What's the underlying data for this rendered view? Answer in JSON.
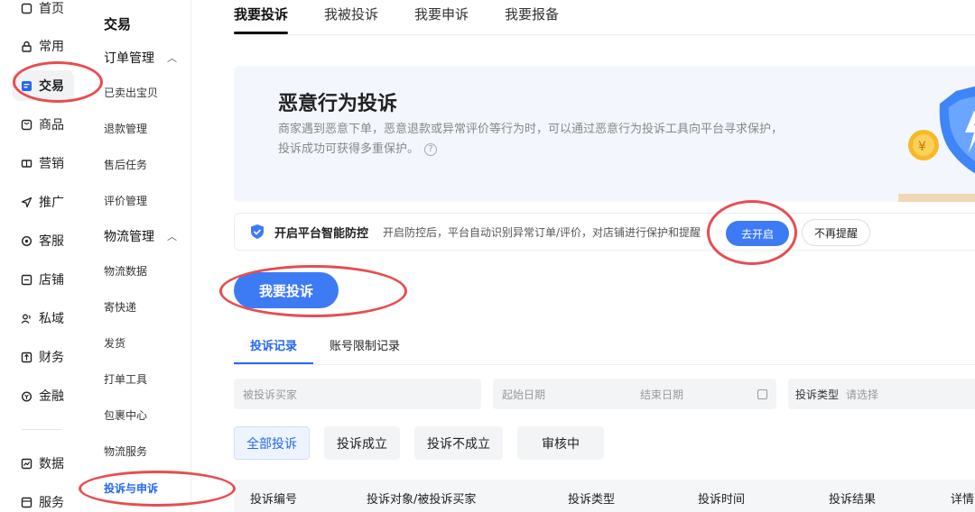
{
  "nav_primary": [
    {
      "label": "首页",
      "icon": "home-icon"
    },
    {
      "label": "常用",
      "icon": "lock-icon"
    },
    {
      "label": "交易",
      "icon": "document-icon",
      "active": true
    },
    {
      "label": "商品",
      "icon": "box-icon"
    },
    {
      "label": "营销",
      "icon": "ticket-icon"
    },
    {
      "label": "推广",
      "icon": "send-icon"
    },
    {
      "label": "客服",
      "icon": "headset-icon"
    },
    {
      "label": "店铺",
      "icon": "store-icon"
    },
    {
      "label": "私域",
      "icon": "users-icon"
    },
    {
      "label": "财务",
      "icon": "finance-icon"
    },
    {
      "label": "金融",
      "icon": "coin-icon"
    },
    {
      "label": "数据",
      "icon": "chart-icon"
    },
    {
      "label": "服务",
      "icon": "service-icon"
    }
  ],
  "nav_secondary": {
    "title": "交易",
    "order_group": "订单管理",
    "order_items": [
      "已卖出宝贝",
      "退款管理",
      "售后任务",
      "评价管理"
    ],
    "logistics_group": "物流管理",
    "logistics_items": [
      "物流数据",
      "寄快递",
      "发货",
      "打单工具",
      "包裹中心",
      "物流服务"
    ],
    "active_item": "投诉与申诉"
  },
  "tabs": [
    "我要投诉",
    "我被投诉",
    "我要申诉",
    "我要报备"
  ],
  "banner": {
    "title": "恶意行为投诉",
    "desc": "商家遇到恶意下单，恶意退款或异常评价等行为时，可以通过恶意行为投诉工具向平台寻求保护，投诉成功可获得多重保护。"
  },
  "notice": {
    "title": "开启平台智能防控",
    "desc": "开启防控后，平台自动识别异常订单/评价，对店铺进行保护和提醒",
    "open_label": "去开启",
    "ignore_label": "不再提醒"
  },
  "primary_button": "我要投诉",
  "subtabs": [
    "投诉记录",
    "账号限制记录"
  ],
  "search": {
    "buyer_placeholder": "被投诉买家",
    "start_date": "起始日期",
    "end_date": "结束日期",
    "type_label": "投诉类型",
    "type_placeholder": "请选择"
  },
  "filters": [
    "全部投诉",
    "投诉成立",
    "投诉不成立",
    "审核中"
  ],
  "table_headers": [
    "投诉编号",
    "投诉对象/被投诉买家",
    "投诉类型",
    "投诉时间",
    "投诉结果",
    "详情"
  ],
  "colors": {
    "accent": "#3d7bf5",
    "annotation": "#e84c4f"
  }
}
